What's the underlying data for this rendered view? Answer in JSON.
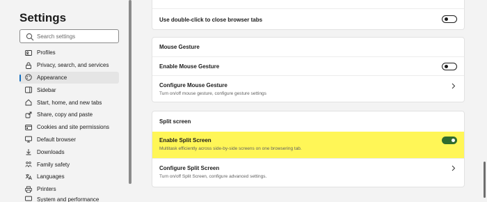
{
  "sidebar": {
    "title": "Settings",
    "search_placeholder": "Search settings",
    "items": [
      {
        "label": "Profiles",
        "icon": "profile-icon"
      },
      {
        "label": "Privacy, search, and services",
        "icon": "lock-icon"
      },
      {
        "label": "Appearance",
        "icon": "appearance-icon"
      },
      {
        "label": "Sidebar",
        "icon": "sidebar-icon"
      },
      {
        "label": "Start, home, and new tabs",
        "icon": "home-icon"
      },
      {
        "label": "Share, copy and paste",
        "icon": "share-icon"
      },
      {
        "label": "Cookies and site permissions",
        "icon": "cookies-icon"
      },
      {
        "label": "Default browser",
        "icon": "browser-icon"
      },
      {
        "label": "Downloads",
        "icon": "download-icon"
      },
      {
        "label": "Family safety",
        "icon": "family-icon"
      },
      {
        "label": "Languages",
        "icon": "languages-icon"
      },
      {
        "label": "Printers",
        "icon": "printer-icon"
      },
      {
        "label": "System and performance",
        "icon": "system-icon"
      }
    ],
    "active_index": 2
  },
  "main": {
    "tab_close": {
      "label": "Use double-click to close browser tabs",
      "toggle": "off"
    },
    "mouse_gesture": {
      "header": "Mouse Gesture",
      "enable": {
        "label": "Enable Mouse Gesture",
        "toggle": "off"
      },
      "configure": {
        "label": "Configure Mouse Gesture",
        "desc": "Turn on/off mouse gesture, configure gesture settings"
      }
    },
    "split_screen": {
      "header": "Split screen",
      "enable": {
        "label": "Enable Split Screen",
        "desc": "Multitask efficiently across side-by-side screens on one browsering tab.",
        "toggle": "on"
      },
      "configure": {
        "label": "Configure Split Screen",
        "desc": "Turn on/off Split Screen, configure advanced settings."
      }
    }
  },
  "colors": {
    "accent": "#0f6cbd",
    "toggle_on": "#2f6b2f",
    "highlight": "#fff657"
  }
}
